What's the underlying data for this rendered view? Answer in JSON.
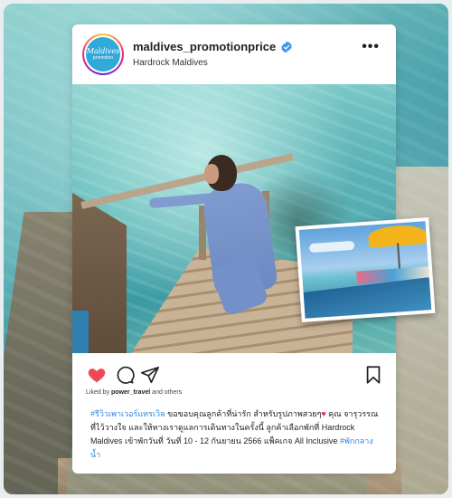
{
  "post": {
    "username": "maldives_promotionprice",
    "location": "Hardrock Maldives",
    "avatar_line1": "Maldives",
    "avatar_line2": "promotion",
    "more_label": "•••",
    "liked_by_prefix": "Liked by",
    "liked_by_user": "power_travel",
    "liked_by_suffix": "and others",
    "caption_hashtag1": "#รีวิวเพาเวอร์แทรเวิล",
    "caption_part1": " ขอขอบคุณลูกค้าที่น่ารัก สำหรับรูปภาพสวยๆ",
    "caption_heart": "♥",
    "caption_part2": " คุณ จารุวรรณ ที่ไว้วางใจ และให้ทางเราดูแลการเดินทางในครั้งนี้ ลูกค้าเลือกพักที่ Hardrock Maldives เข้าพักวันที่ วันที่ 10 - 12 กันยายน 2566 แพ็คเกจ All Inclusive ",
    "caption_hashtag2": "#พักกลางน้ำ"
  },
  "colors": {
    "like_red": "#ed4956",
    "hashtag_blue": "#2e86de",
    "verified_blue": "#3897f0"
  },
  "icons": {
    "like": "heart-icon",
    "comment": "comment-icon",
    "share": "paper-plane-icon",
    "save": "bookmark-icon",
    "verified": "verified-badge-icon",
    "more": "more-icon"
  }
}
